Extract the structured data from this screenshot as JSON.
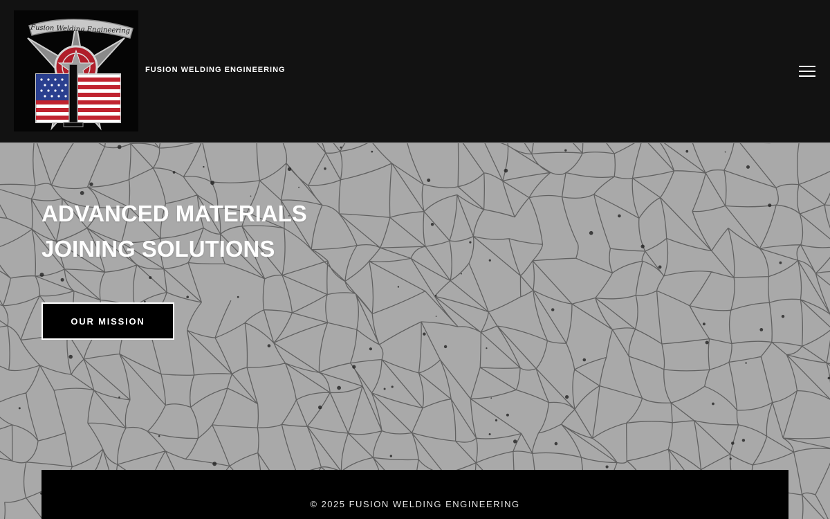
{
  "header": {
    "site_title": "FUSION WELDING ENGINEERING",
    "logo": {
      "icon": "fusion-welding-emblem",
      "banner_text": "Fusion Welding Engineering"
    },
    "menu_icon": "hamburger-menu-icon"
  },
  "hero": {
    "title_lines": [
      "ADVANCED MATERIALS",
      "JOINING SOLUTIONS"
    ],
    "cta_label": "OUR MISSION",
    "background": "metallographic-grain-texture"
  },
  "footer": {
    "copyright": "© 2025 FUSION WELDING ENGINEERING"
  },
  "colors": {
    "header_bg": "#121212",
    "hero_bg": "#a9a9a9",
    "button_bg": "#000000",
    "text": "#ffffff"
  }
}
